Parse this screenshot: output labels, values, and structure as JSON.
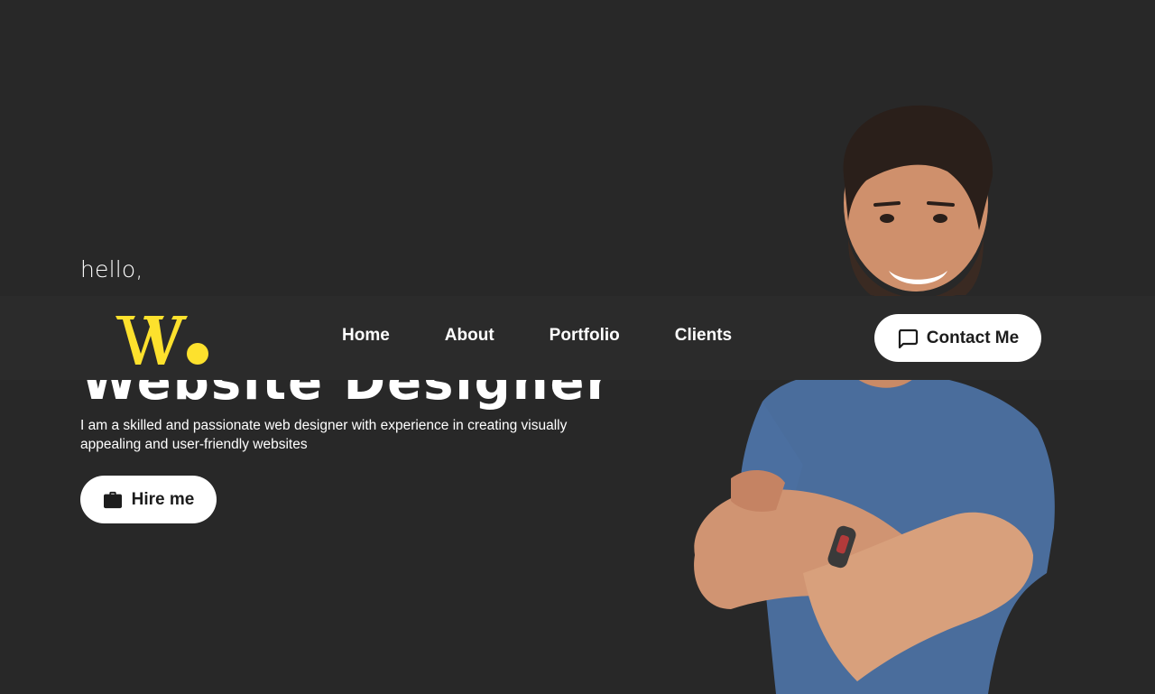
{
  "hero": {
    "greeting": "hello,",
    "headline": "Website Designer",
    "tagline": "I am a skilled and passionate web designer with experience in creating visually appealing and user-friendly websites",
    "hire_button": {
      "label": "Hire me",
      "icon": "briefcase-icon"
    }
  },
  "nav": {
    "logo": {
      "letter": "W",
      "accent_color": "#fde12d"
    },
    "links": [
      {
        "label": "Home"
      },
      {
        "label": "About"
      },
      {
        "label": "Portfolio"
      },
      {
        "label": "Clients"
      }
    ],
    "contact_button": {
      "label": "Contact Me",
      "icon": "chat-bubble-icon"
    }
  },
  "theme": {
    "background": "#282828",
    "navbar_background": "#2b2b2b",
    "accent": "#fde12d",
    "button_background": "#ffffff",
    "button_text": "#1c1c1c"
  }
}
